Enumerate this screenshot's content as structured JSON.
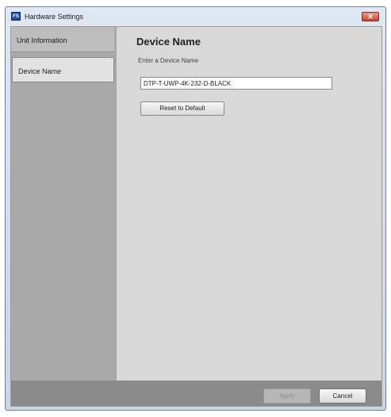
{
  "window": {
    "title": "Hardware Settings",
    "app_icon_text": "FS",
    "close_glyph": "✕"
  },
  "sidebar": {
    "items": [
      {
        "label": "Unit Information"
      },
      {
        "label": "Device Name",
        "selected": true
      }
    ]
  },
  "main": {
    "heading": "Device Name",
    "prompt": "Enter a Device Name",
    "device_name_value": "DTP-T-UWP-4K-232-D-BLACK",
    "reset_label": "Reset to Default"
  },
  "footer": {
    "apply_label": "Apply",
    "cancel_label": "Cancel"
  },
  "colors": {
    "sidebar_bg": "#a9a9a9",
    "main_bg": "#d9d9d9",
    "footer_bg": "#8b8b8b",
    "close_red": "#c8432b"
  }
}
